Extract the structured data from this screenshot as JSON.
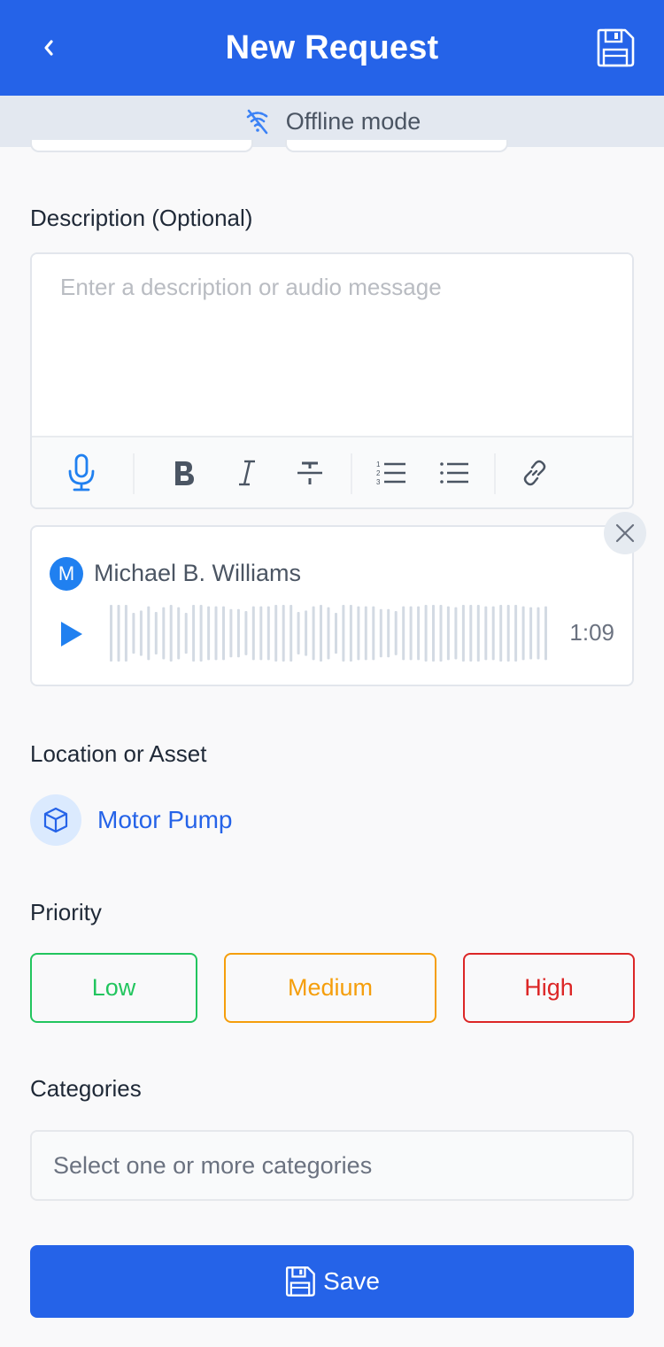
{
  "header": {
    "title": "New Request",
    "back_icon": "chevron-left-icon",
    "save_icon": "floppy-disk-icon"
  },
  "status_bar": {
    "icon": "wifi-off-icon",
    "text": "Offline mode"
  },
  "description": {
    "label": "Description (Optional)",
    "placeholder": "Enter a description or audio message",
    "value": "",
    "toolbar": [
      {
        "name": "microphone",
        "icon": "microphone-icon"
      },
      {
        "name": "bold",
        "icon": "bold-icon"
      },
      {
        "name": "italic",
        "icon": "italic-icon"
      },
      {
        "name": "strikethrough",
        "icon": "strikethrough-icon"
      },
      {
        "name": "ordered-list",
        "icon": "ordered-list-icon"
      },
      {
        "name": "bullet-list",
        "icon": "bullet-list-icon"
      },
      {
        "name": "link",
        "icon": "link-icon"
      }
    ]
  },
  "audio_message": {
    "author_initial": "M",
    "author": "Michael B. Williams",
    "duration": "1:09",
    "waveform_levels": [
      1,
      1,
      1,
      0.72,
      0.8,
      0.95,
      0.75,
      0.92,
      1,
      0.92,
      0.72,
      1,
      1,
      0.95,
      0.95,
      0.95,
      0.85,
      0.85,
      0.78,
      0.95,
      0.95,
      0.95,
      1,
      1,
      1,
      0.75,
      0.8,
      0.95,
      1,
      0.92,
      0.72,
      1,
      1,
      0.95,
      0.95,
      0.95,
      0.85,
      0.85,
      0.78,
      0.95,
      0.95,
      0.95,
      1,
      1,
      1,
      0.95,
      0.92,
      1,
      1,
      1,
      0.95,
      0.95,
      1,
      1,
      1,
      0.95,
      0.92,
      0.92,
      0.95
    ],
    "colors": {
      "wave": "#d3dae3",
      "play": "#2080f0"
    }
  },
  "location": {
    "label": "Location or Asset",
    "asset_icon": "cube-icon",
    "asset_name": "Motor Pump"
  },
  "priority": {
    "label": "Priority",
    "options": [
      {
        "label": "Low",
        "color": "#22c55e"
      },
      {
        "label": "Medium",
        "color": "#f59e0b"
      },
      {
        "label": "High",
        "color": "#dc2626"
      }
    ]
  },
  "categories": {
    "label": "Categories",
    "placeholder": "Select one or more categories"
  },
  "save_button": {
    "label": "Save",
    "icon": "floppy-disk-icon"
  },
  "theme": {
    "primary": "#2563e8",
    "offline_bg": "#e3e8f0"
  }
}
